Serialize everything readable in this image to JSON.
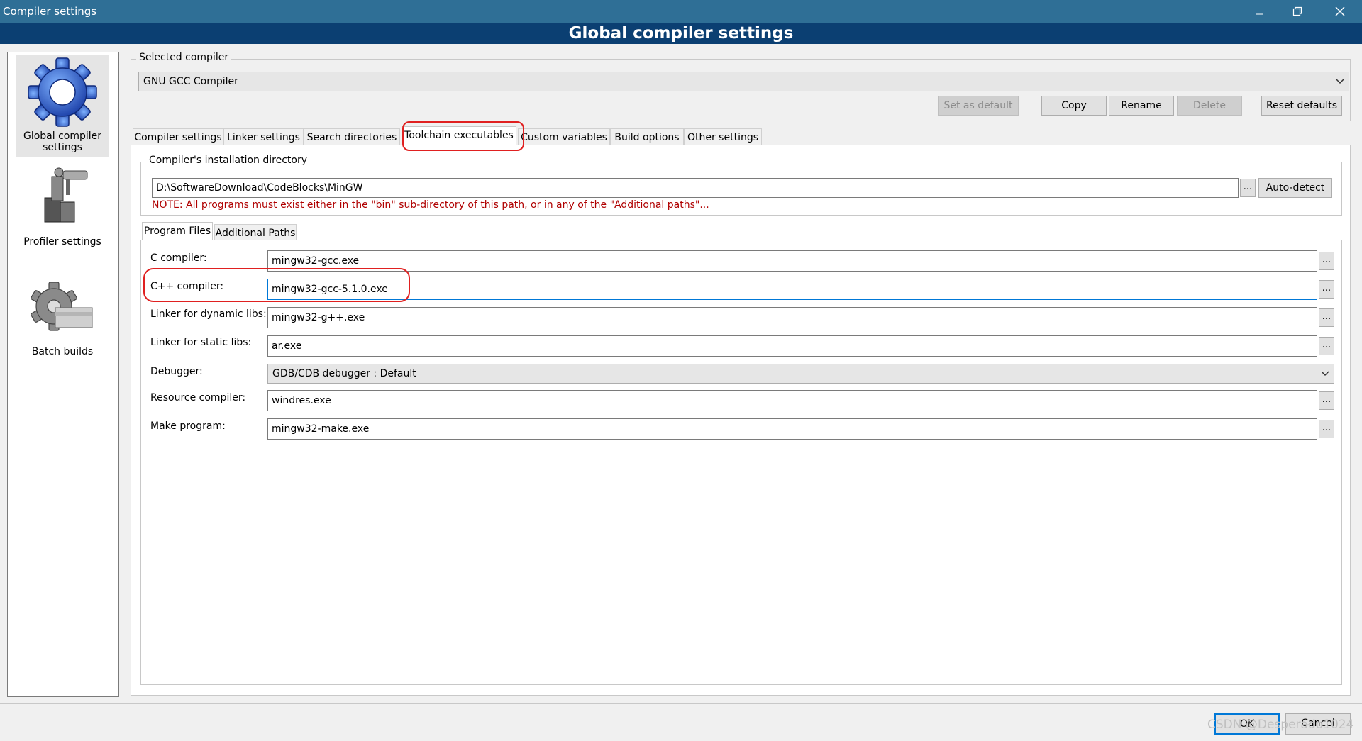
{
  "window": {
    "title": "Compiler settings",
    "header": "Global compiler settings"
  },
  "left_panel": {
    "items": [
      {
        "label": "Global compiler settings",
        "icon": "gear-icon",
        "selected": true
      },
      {
        "label": "Profiler settings",
        "icon": "profiler-icon",
        "selected": false
      },
      {
        "label": "Batch builds",
        "icon": "batch-builds-icon",
        "selected": false
      }
    ]
  },
  "selected_compiler": {
    "label": "Selected compiler",
    "value": "GNU GCC Compiler",
    "buttons": {
      "set_default": "Set as default",
      "copy": "Copy",
      "rename": "Rename",
      "delete": "Delete",
      "reset": "Reset defaults"
    }
  },
  "tabs": [
    "Compiler settings",
    "Linker settings",
    "Search directories",
    "Toolchain executables",
    "Custom variables",
    "Build options",
    "Other settings"
  ],
  "active_tab": "Toolchain executables",
  "install_dir": {
    "label": "Compiler's installation directory",
    "value": "D:\\SoftwareDownload\\CodeBlocks\\MinGW",
    "browse": "...",
    "autodetect": "Auto-detect",
    "note": "NOTE: All programs must exist either in the \"bin\" sub-directory of this path, or in any of the \"Additional paths\"..."
  },
  "subtabs": [
    "Program Files",
    "Additional Paths"
  ],
  "program_files": {
    "c_compiler": {
      "label": "C compiler:",
      "value": "mingw32-gcc.exe"
    },
    "cpp_compiler": {
      "label": "C++ compiler:",
      "value": "mingw32-gcc-5.1.0.exe"
    },
    "linker_dynamic": {
      "label": "Linker for dynamic libs:",
      "value": "mingw32-g++.exe"
    },
    "linker_static": {
      "label": "Linker for static libs:",
      "value": "ar.exe"
    },
    "debugger": {
      "label": "Debugger:",
      "value": "GDB/CDB debugger : Default"
    },
    "resource_compiler": {
      "label": "Resource compiler:",
      "value": "windres.exe"
    },
    "make_program": {
      "label": "Make program:",
      "value": "mingw32-make.exe"
    },
    "browse": "..."
  },
  "footer": {
    "ok": "OK",
    "cancel": "Cancel",
    "watermark": "CSDN @Desperado1024"
  },
  "colors": {
    "titlebar": "#2f6f96",
    "banner": "#0b3f72",
    "note": "#b00000",
    "annotation": "#e02020"
  }
}
